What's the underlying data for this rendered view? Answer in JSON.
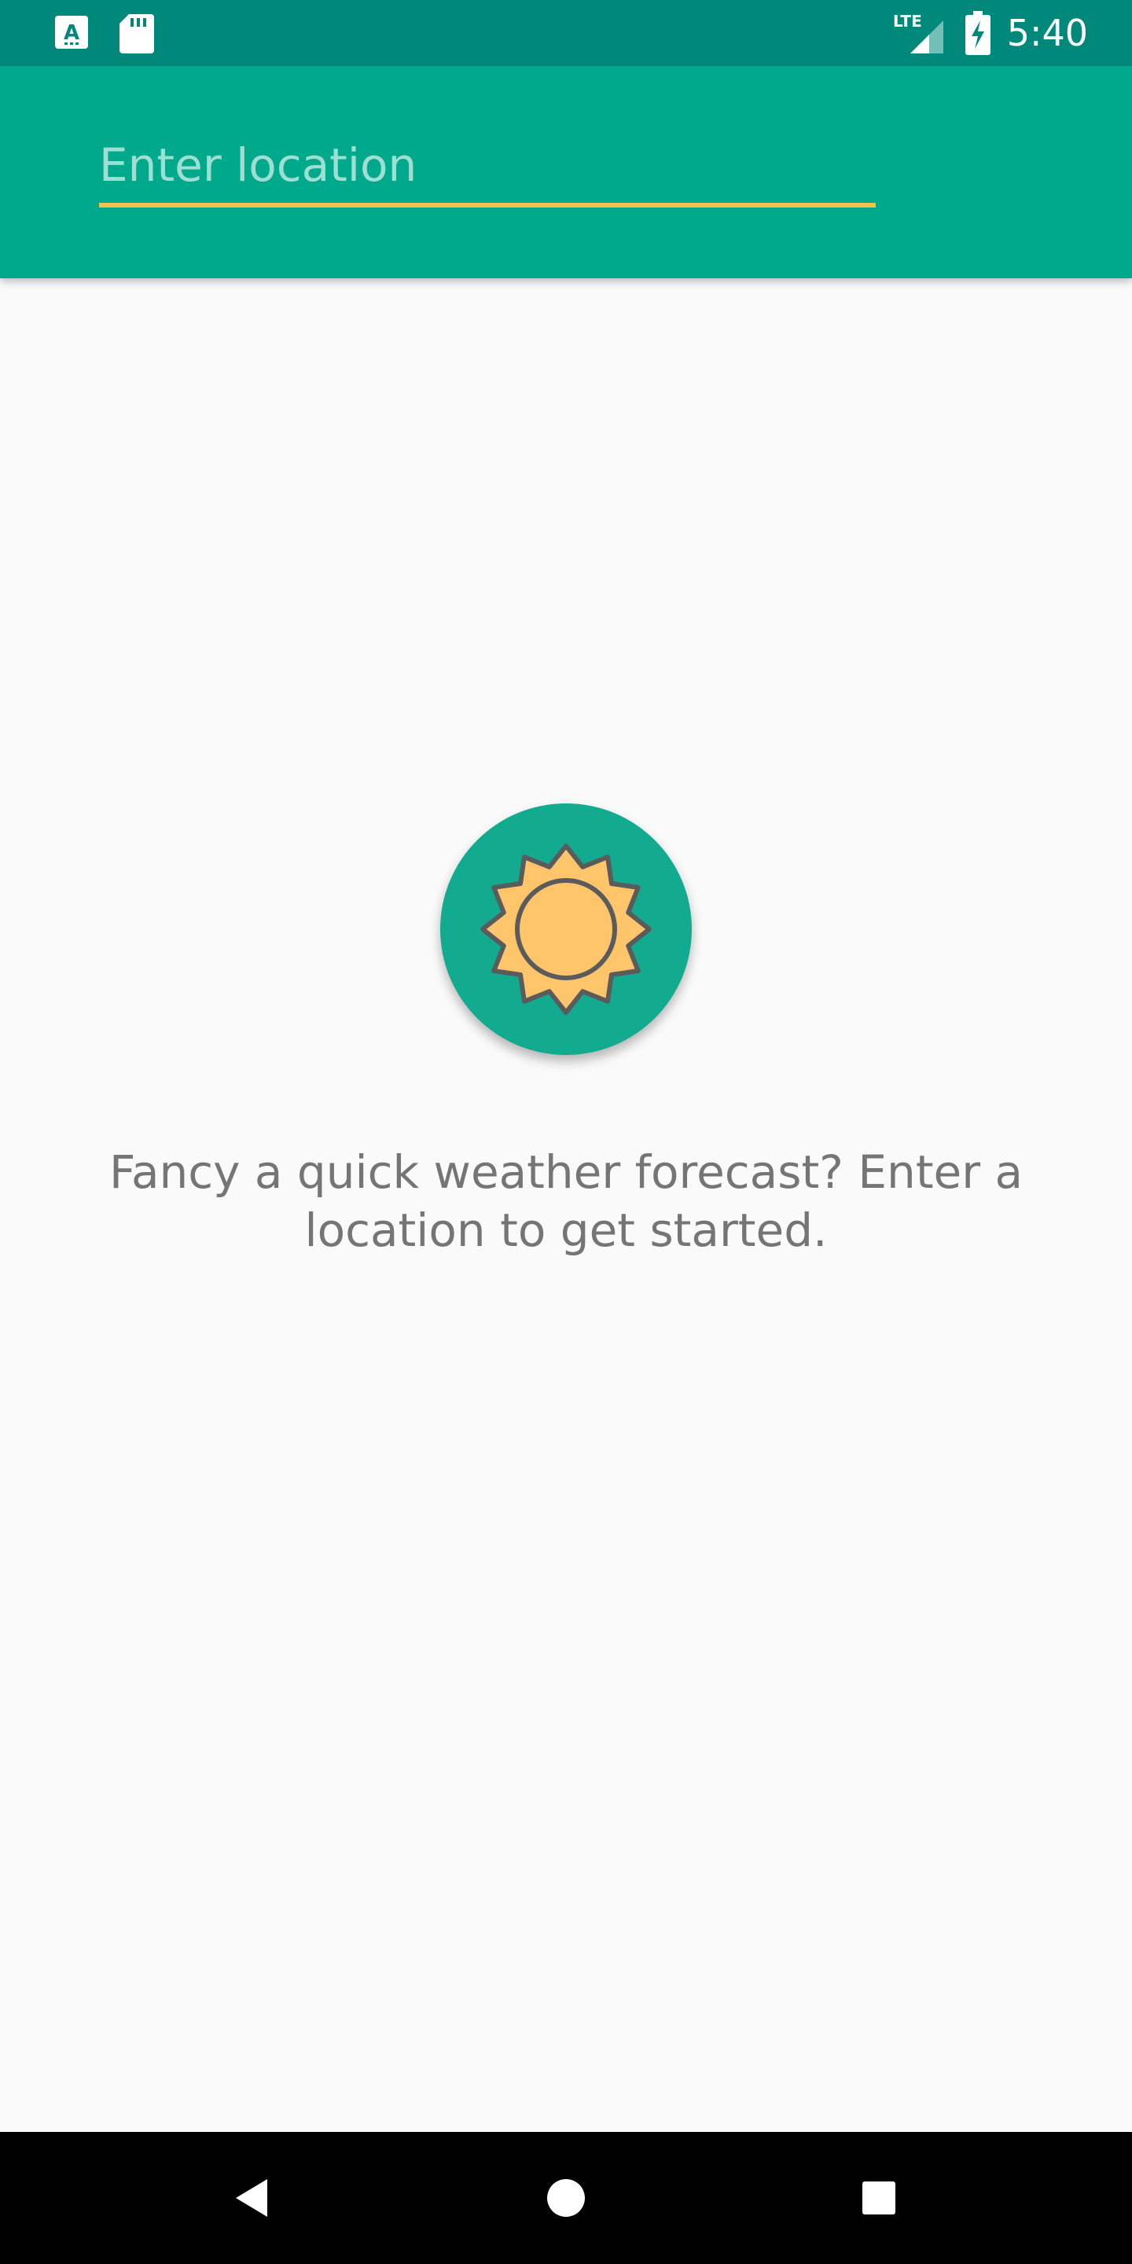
{
  "status_bar": {
    "time": "5:40",
    "icons": [
      "keyboard-a-icon",
      "sd-card-icon",
      "lte-signal-icon",
      "battery-charging-icon"
    ],
    "network_label": "LTE"
  },
  "app_bar": {
    "search": {
      "placeholder": "Enter location",
      "value": ""
    },
    "accent_color": "#00a98b",
    "underline_color": "#f2c14e"
  },
  "empty_state": {
    "icon": "sun-icon",
    "message": "Fancy a quick weather forecast? Enter a location to get started."
  },
  "nav_bar": {
    "buttons": [
      "back-icon",
      "home-icon",
      "recents-icon"
    ]
  },
  "colors": {
    "status_bar": "#00897b",
    "app_bar": "#00a98b",
    "badge": "#12ab90",
    "sun_fill": "#ffc56b",
    "sun_stroke": "#5b5b5b",
    "text": "#757575",
    "background": "#fafafa"
  }
}
